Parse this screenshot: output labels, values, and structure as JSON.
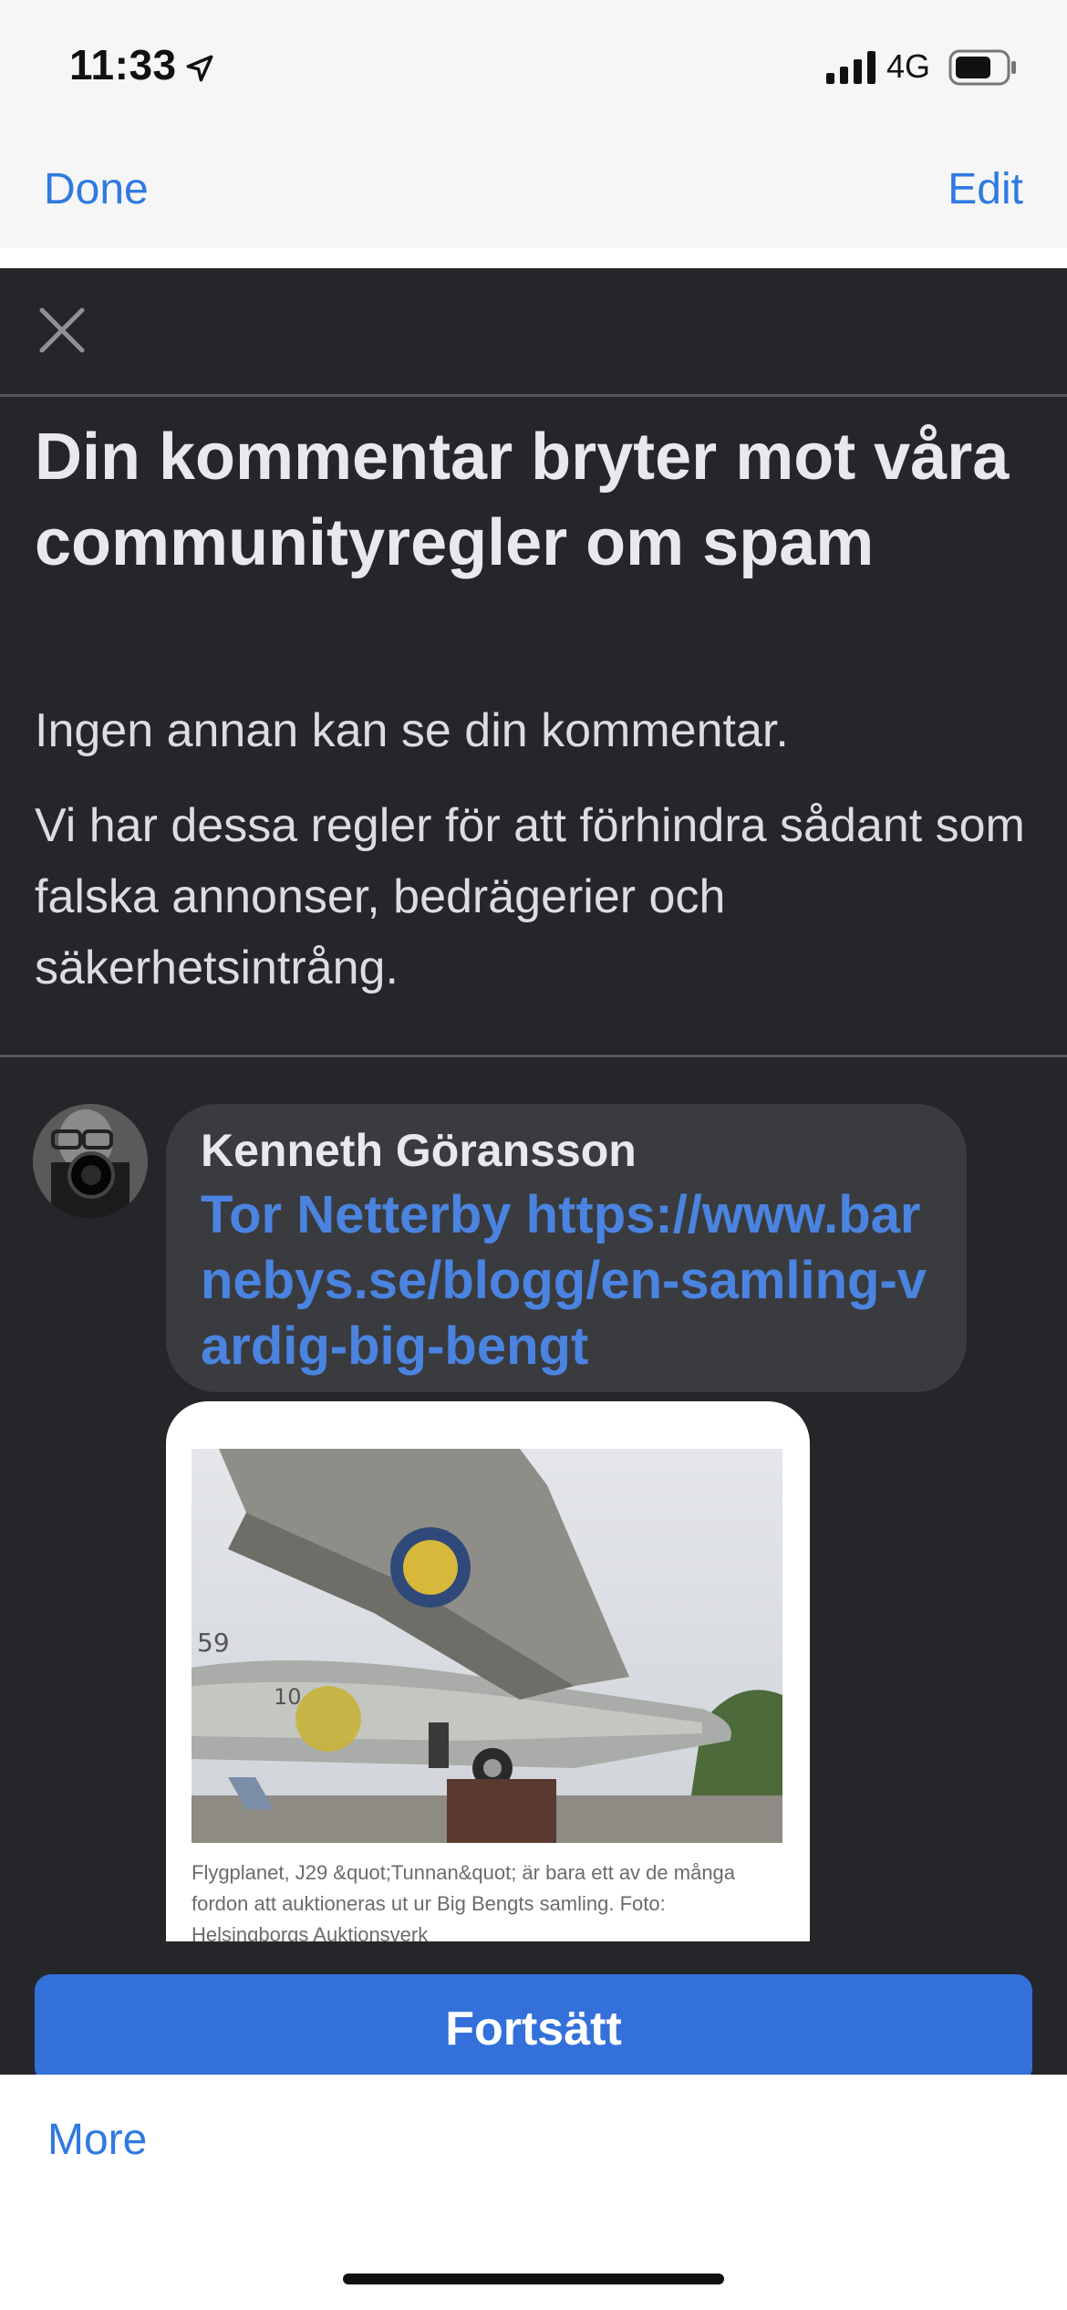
{
  "status_bar": {
    "time": "11:33",
    "network": "4G",
    "icons": [
      "location-arrow-icon",
      "signal-icon",
      "battery-icon"
    ]
  },
  "nav": {
    "done_label": "Done",
    "edit_label": "Edit"
  },
  "modal": {
    "close_icon": "close-icon",
    "headline": "Din kommentar bryter mot våra communityregler om spam",
    "subtext_1": "Ingen annan kan se din kommentar.",
    "subtext_2": "Vi har dessa regler för att förhindra sådant som falska annonser, bedrägerier och säkerhetsintrång.",
    "comment": {
      "author": "Kenneth Göransson",
      "text": "Tor Netterby https://www.barnebys.se/blogg/en-samling-vardig-big-bengt"
    },
    "link_preview": {
      "caption": "Flygplanet, J29 &quot;Tunnan&quot; är bara ett av de många fordon att auktioneras ut ur Big Bengts samling. Foto: Helsingborgs Auktionsverk"
    },
    "continue_label": "Fortsätt"
  },
  "bottom_sheet": {
    "more_label": "More"
  },
  "colors": {
    "accent": "#2f7ae0",
    "modal_bg": "#25262a",
    "bubble_bg": "#3a3b3f",
    "button": "#3370da",
    "link": "#4a84e0"
  }
}
